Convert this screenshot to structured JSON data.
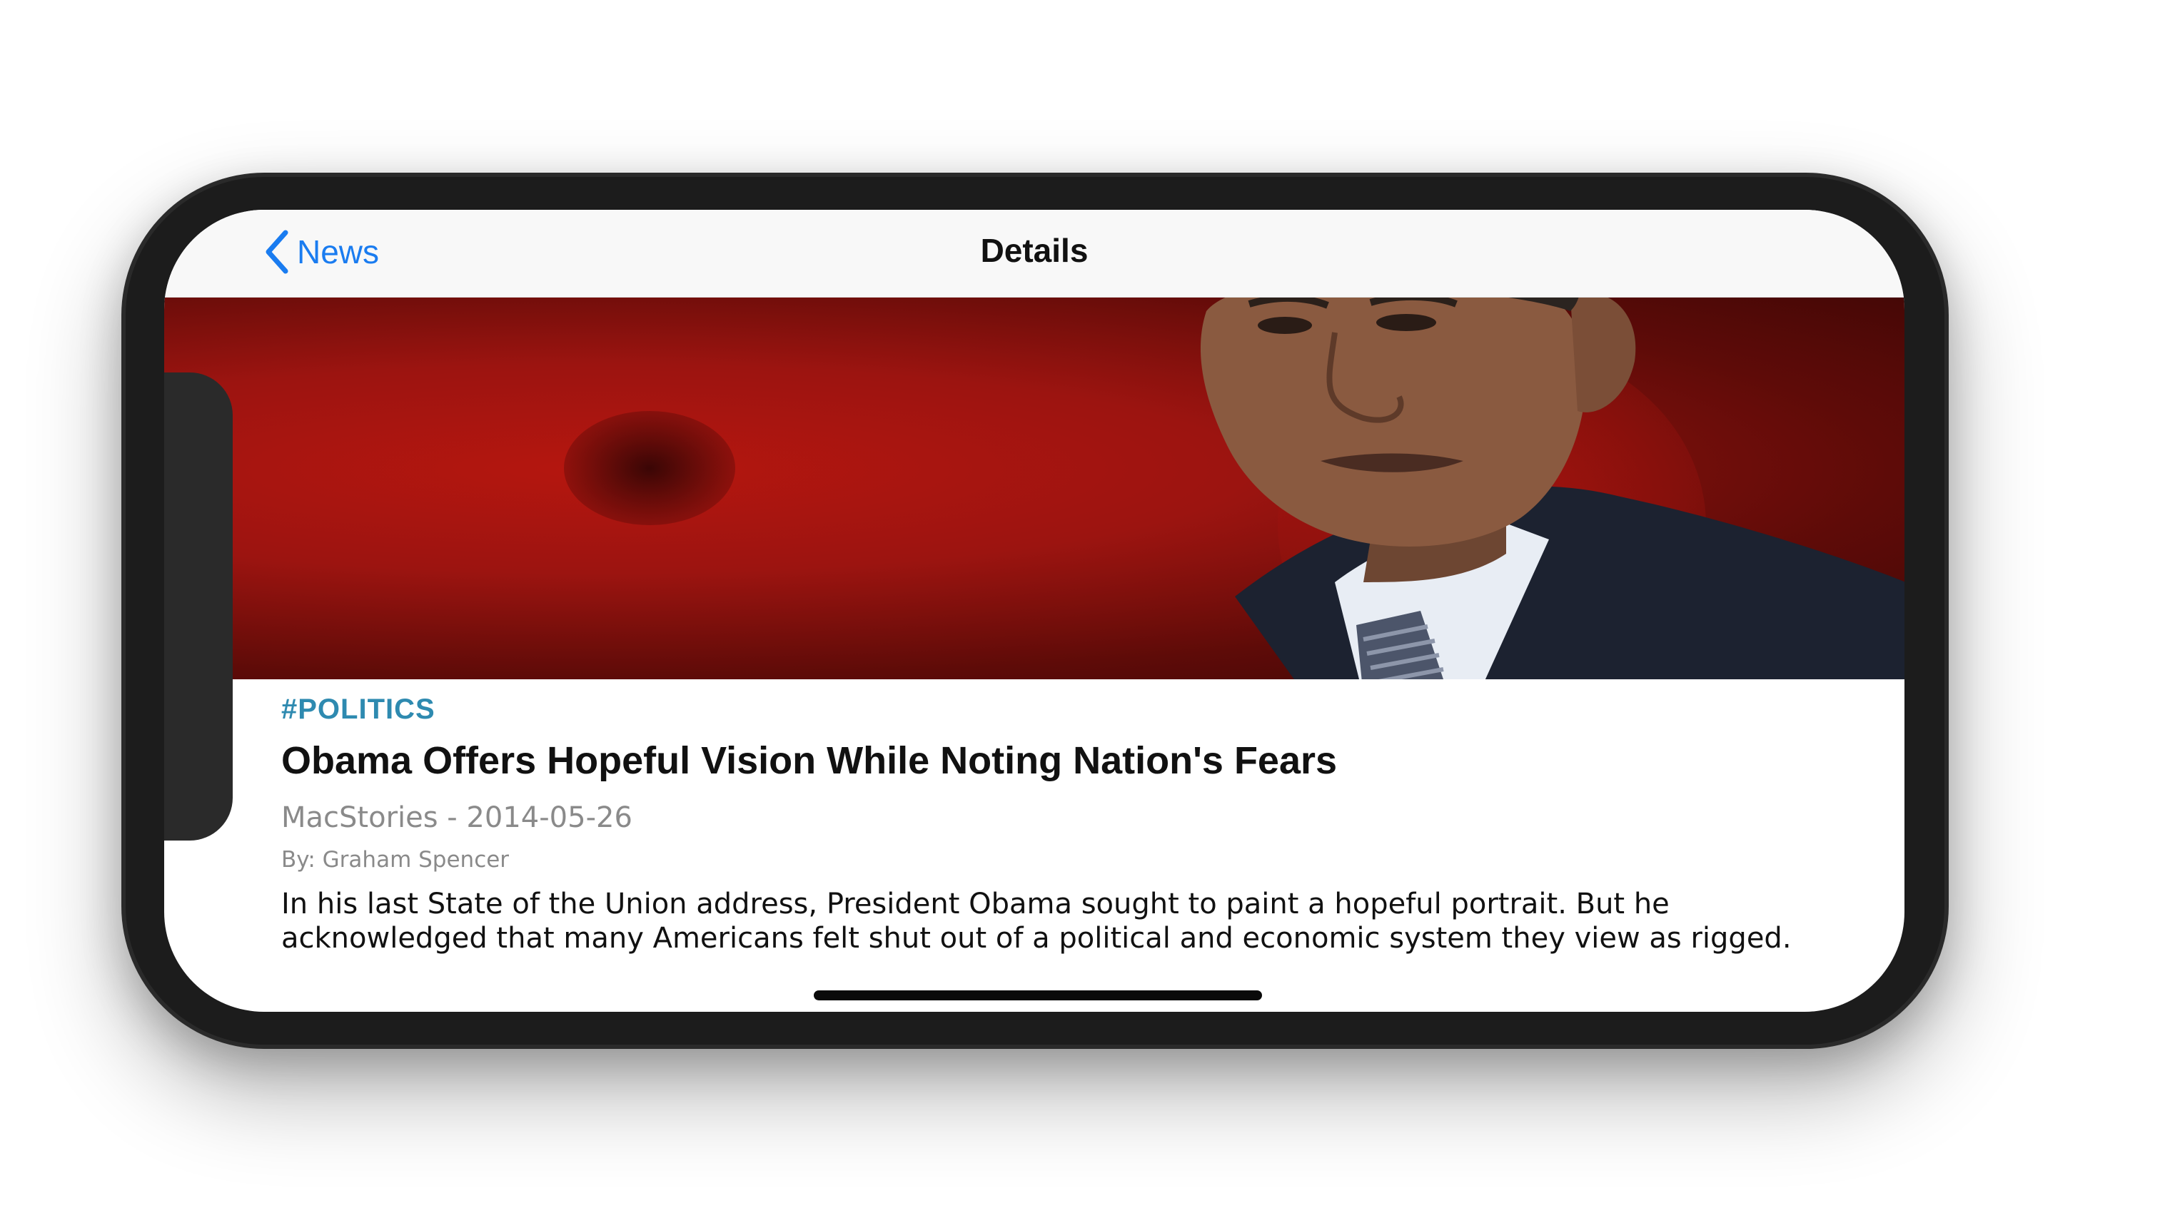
{
  "navbar": {
    "back_label": "News",
    "title": "Details"
  },
  "hero": {
    "icon": "article-photo",
    "background_color": "#b5160f"
  },
  "article": {
    "category": "#POLITICS",
    "headline": "Obama Offers Hopeful Vision While Noting Nation's Fears",
    "source_date": "MacStories - 2014-05-26",
    "byline": "By: Graham Spencer",
    "summary": "In his last State of the Union address, President Obama sought to paint a hopeful portrait. But he acknowledged that many Americans felt shut out of a political and economic system they view as rigged."
  },
  "colors": {
    "accent": "#1a7cf0",
    "category": "#2e8ab0",
    "secondary_text": "#8a8a8a"
  }
}
